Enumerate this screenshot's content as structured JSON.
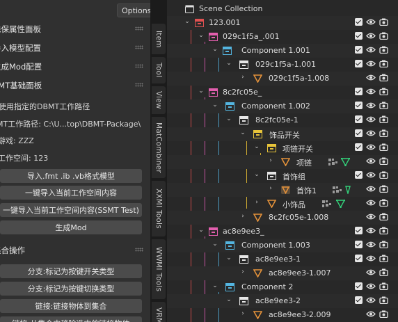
{
  "left_panel": {
    "options_label": "Options",
    "sections": [
      {
        "label": "珠保属性面板"
      },
      {
        "label": "导入模型配置"
      },
      {
        "label": "生成Mod配置"
      },
      {
        "label": "SMT基础面板"
      }
    ],
    "use_path_label": "使用指定的DBMT工作路径",
    "work_path": "MT工作路径: C:\\U...top\\DBMT-Package\\",
    "game": "游戏: ZZZ",
    "workspace": "工作空间: 123",
    "buttons": [
      "导入.fmt .ib .vb格式模型",
      "一键导入当前工作空间内容",
      "一键导入当前工作空间内容(SSMT Test)",
      "生成Mod"
    ],
    "combine_section": "集合操作",
    "combine_buttons": [
      "分支:标记为按键开关类型",
      "分支:标记为按键切换类型",
      "链接:链接物体到集合",
      "链接:从集合中移除选中的链接物体"
    ]
  },
  "tabs": [
    "Item",
    "Tool",
    "View",
    "MatCombiner",
    "XXMI Tools",
    "WWMI Tools",
    "VRM"
  ],
  "outliner": {
    "root": "Scene Collection",
    "rows": [
      {
        "label": "123.001",
        "kind": "collection",
        "color": "#e05151"
      },
      {
        "label": "029c1f5a_.001",
        "kind": "collection",
        "color": "#e25fae"
      },
      {
        "label": "Component 1.001",
        "kind": "collection",
        "color": "#54b5e0"
      },
      {
        "label": "029c1f5a-1.001",
        "kind": "collection",
        "color": "#e6e6e6"
      },
      {
        "label": "029c1f5a-1.008",
        "kind": "object"
      },
      {
        "label": "8c2fc05e_",
        "kind": "collection",
        "color": "#e25fae"
      },
      {
        "label": "Component 1.002",
        "kind": "collection",
        "color": "#54b5e0"
      },
      {
        "label": "8c2fc05e-1",
        "kind": "collection",
        "color": "#e6e6e6"
      },
      {
        "label": "饰品开关",
        "kind": "collection",
        "color": "#e8c43a"
      },
      {
        "label": "项链开关",
        "kind": "collection",
        "color": "#e8c43a"
      },
      {
        "label": "项链",
        "kind": "object"
      },
      {
        "label": "首饰组",
        "kind": "collection",
        "color": "#e6e6e6"
      },
      {
        "label": "首饰1",
        "kind": "object"
      },
      {
        "label": "小饰品",
        "kind": "object"
      },
      {
        "label": "8c2fc05e-1.008",
        "kind": "object"
      },
      {
        "label": "ac8e9ee3_",
        "kind": "collection",
        "color": "#e25fae"
      },
      {
        "label": "Component 1.003",
        "kind": "collection",
        "color": "#54b5e0"
      },
      {
        "label": "ac8e9ee3-1",
        "kind": "collection",
        "color": "#e6e6e6"
      },
      {
        "label": "ac8e9ee3-1.007",
        "kind": "object"
      },
      {
        "label": "Component 2",
        "kind": "collection",
        "color": "#54b5e0"
      },
      {
        "label": "ac8e9ee3-2",
        "kind": "collection",
        "color": "#e6e6e6"
      },
      {
        "label": "ac8e9ee3-2.009",
        "kind": "object"
      }
    ]
  },
  "colors": {
    "accent_object": "#e3913a",
    "modifier_green": "#33d17a"
  }
}
